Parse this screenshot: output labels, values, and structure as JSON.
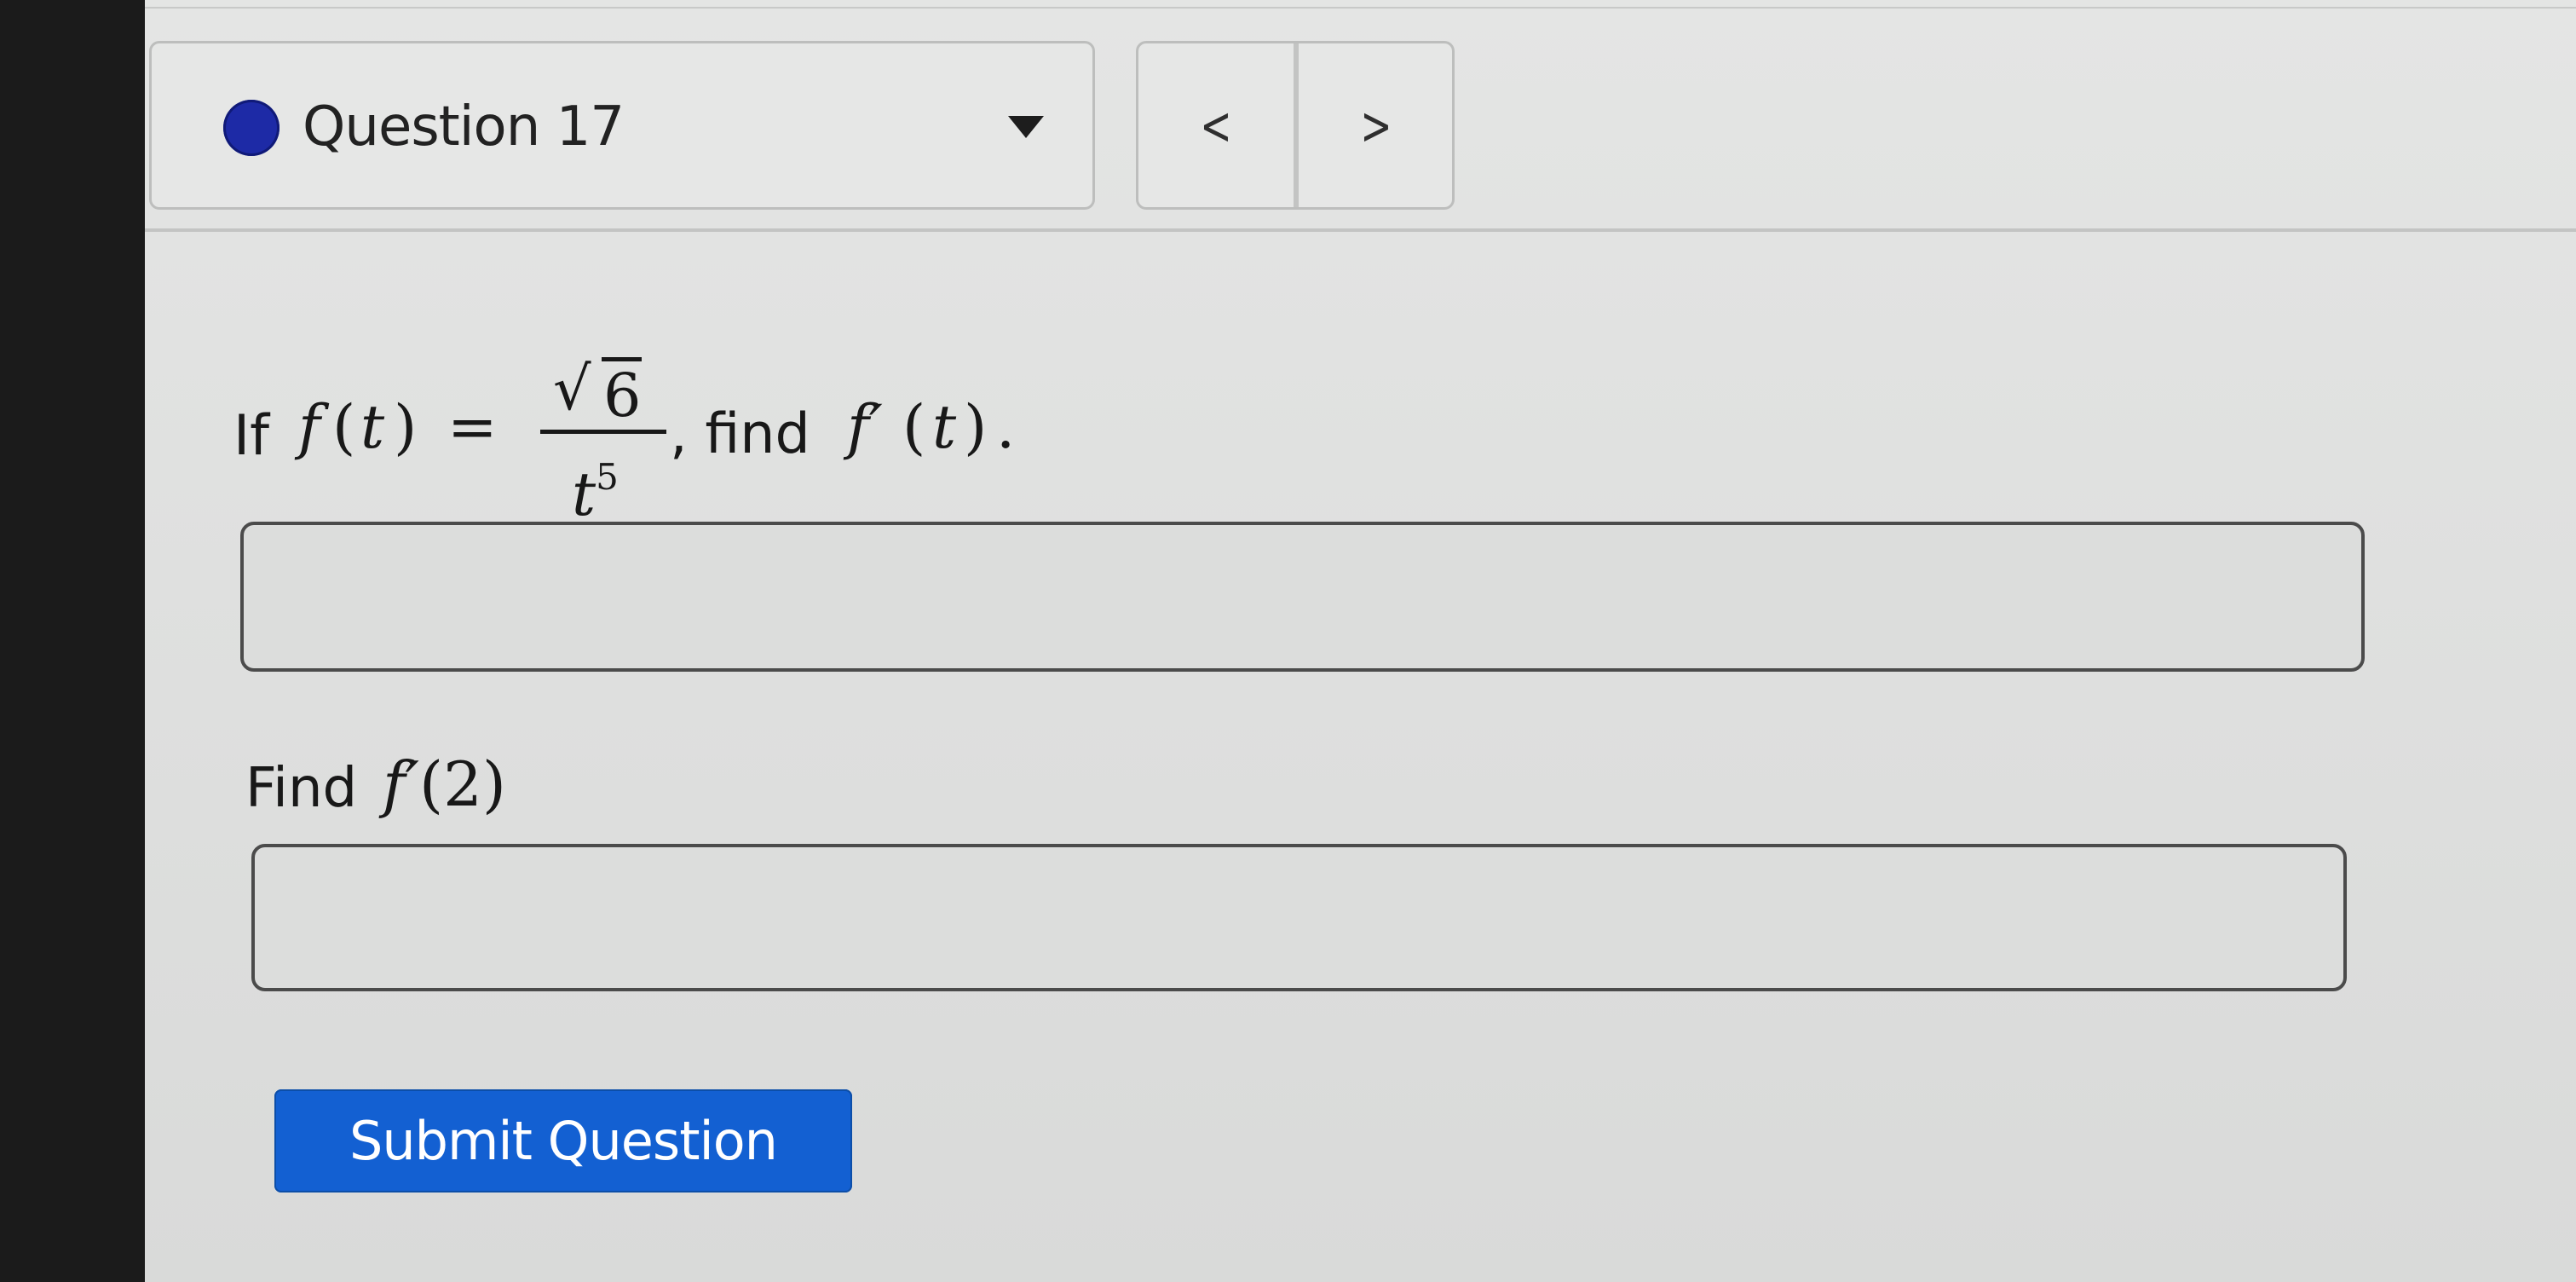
{
  "header": {
    "question_label": "Question 17",
    "status_color": "#1d2aa6",
    "dropdown_icon": "caret-down-icon",
    "previous_label": "<",
    "next_label": ">"
  },
  "question": {
    "prompt_intro": "If",
    "function_name": "f",
    "variable": "t",
    "equals": "=",
    "radical_symbol": "√",
    "numerator_radicand": "6",
    "denominator_base": "t",
    "denominator_exponent": "5",
    "prompt_find": ", find",
    "derivative_name": "f′",
    "prompt_end": "."
  },
  "answers": {
    "first_value": "",
    "second_value": ""
  },
  "second_prompt": {
    "label": "Find",
    "derivative_name": "f′",
    "argument": "2"
  },
  "actions": {
    "submit_label": "Submit Question",
    "submit_color": "#1360d2"
  }
}
